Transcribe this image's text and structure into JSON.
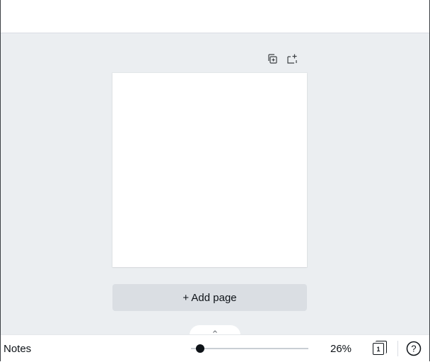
{
  "editor": {
    "page_tools": {
      "duplicate_icon": "duplicate-page-icon",
      "add_icon": "add-page-icon"
    },
    "add_page_label": "+ Add page",
    "drawer_toggle_icon": "chevron-up-icon"
  },
  "footer": {
    "notes_label": "Notes",
    "zoom": {
      "percent": 26,
      "label": "26%"
    },
    "page_count": "1",
    "help_label": "?"
  },
  "colors": {
    "canvas_background": "#ebeef1",
    "add_page_button": "#dadee3",
    "text": "#0e1318"
  }
}
